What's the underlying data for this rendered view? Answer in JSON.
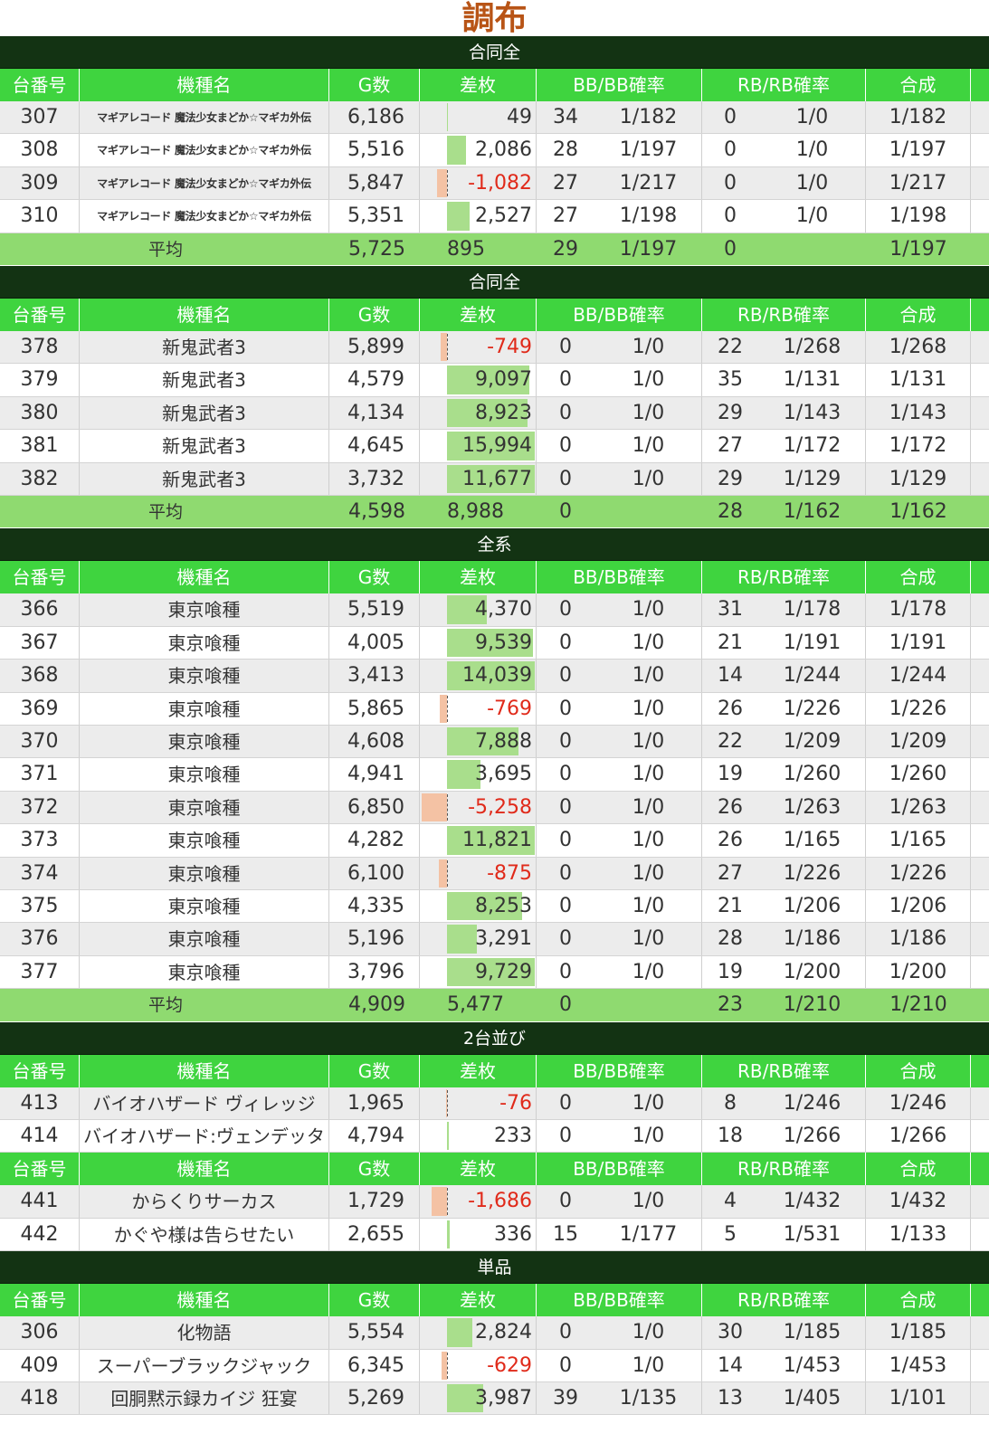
{
  "title": "調布",
  "columns": [
    "台番号",
    "機種名",
    "G数",
    "差枚",
    "BB/BB確率",
    "RB/RB確率",
    "合成"
  ],
  "avg_label": "平均",
  "colors": {
    "title": "#b85416",
    "section_bg": "#133313",
    "header_bg": "#3fd43f",
    "avg_bg": "#8fda70",
    "positive_bar": "#a9de8c",
    "negative_bar": "#f4c2a4",
    "negative_text": "#e02a1a"
  },
  "blocks": [
    {
      "section": "合同全",
      "name_style": "small",
      "rows": [
        {
          "no": "307",
          "name": "マギアレコード 魔法少女まどか☆マギカ外伝",
          "g": "6,186",
          "diff": 49,
          "diff_text": "49",
          "bb": "34",
          "bbr": "1/182",
          "rb": "0",
          "rbr": "1/0",
          "total": "1/182"
        },
        {
          "no": "308",
          "name": "マギアレコード 魔法少女まどか☆マギカ外伝",
          "g": "5,516",
          "diff": 2086,
          "diff_text": "2,086",
          "bb": "28",
          "bbr": "1/197",
          "rb": "0",
          "rbr": "1/0",
          "total": "1/197"
        },
        {
          "no": "309",
          "name": "マギアレコード 魔法少女まどか☆マギカ外伝",
          "g": "5,847",
          "diff": -1082,
          "diff_text": "-1,082",
          "bb": "27",
          "bbr": "1/217",
          "rb": "0",
          "rbr": "1/0",
          "total": "1/217"
        },
        {
          "no": "310",
          "name": "マギアレコード 魔法少女まどか☆マギカ外伝",
          "g": "5,351",
          "diff": 2527,
          "diff_text": "2,527",
          "bb": "27",
          "bbr": "1/198",
          "rb": "0",
          "rbr": "1/0",
          "total": "1/198"
        }
      ],
      "avg": {
        "g": "5,725",
        "diff": "895",
        "bb": "29",
        "bbr": "1/197",
        "rb": "0",
        "rbr": "",
        "total": "1/197"
      }
    },
    {
      "section": "合同全",
      "rows": [
        {
          "no": "378",
          "name": "新鬼武者3",
          "g": "5,899",
          "diff": -749,
          "diff_text": "-749",
          "bb": "0",
          "bbr": "1/0",
          "rb": "22",
          "rbr": "1/268",
          "total": "1/268"
        },
        {
          "no": "379",
          "name": "新鬼武者3",
          "g": "4,579",
          "diff": 9097,
          "diff_text": "9,097",
          "bb": "0",
          "bbr": "1/0",
          "rb": "35",
          "rbr": "1/131",
          "total": "1/131"
        },
        {
          "no": "380",
          "name": "新鬼武者3",
          "g": "4,134",
          "diff": 8923,
          "diff_text": "8,923",
          "bb": "0",
          "bbr": "1/0",
          "rb": "29",
          "rbr": "1/143",
          "total": "1/143"
        },
        {
          "no": "381",
          "name": "新鬼武者3",
          "g": "4,645",
          "diff": 15994,
          "diff_text": "15,994",
          "bb": "0",
          "bbr": "1/0",
          "rb": "27",
          "rbr": "1/172",
          "total": "1/172"
        },
        {
          "no": "382",
          "name": "新鬼武者3",
          "g": "3,732",
          "diff": 11677,
          "diff_text": "11,677",
          "bb": "0",
          "bbr": "1/0",
          "rb": "29",
          "rbr": "1/129",
          "total": "1/129"
        }
      ],
      "avg": {
        "g": "4,598",
        "diff": "8,988",
        "bb": "0",
        "bbr": "",
        "rb": "28",
        "rbr": "1/162",
        "total": "1/162"
      }
    },
    {
      "section": "全系",
      "rows": [
        {
          "no": "366",
          "name": "東京喰種",
          "g": "5,519",
          "diff": 4370,
          "diff_text": "4,370",
          "bb": "0",
          "bbr": "1/0",
          "rb": "31",
          "rbr": "1/178",
          "total": "1/178"
        },
        {
          "no": "367",
          "name": "東京喰種",
          "g": "4,005",
          "diff": 9539,
          "diff_text": "9,539",
          "bb": "0",
          "bbr": "1/0",
          "rb": "21",
          "rbr": "1/191",
          "total": "1/191"
        },
        {
          "no": "368",
          "name": "東京喰種",
          "g": "3,413",
          "diff": 14039,
          "diff_text": "14,039",
          "bb": "0",
          "bbr": "1/0",
          "rb": "14",
          "rbr": "1/244",
          "total": "1/244"
        },
        {
          "no": "369",
          "name": "東京喰種",
          "g": "5,865",
          "diff": -769,
          "diff_text": "-769",
          "bb": "0",
          "bbr": "1/0",
          "rb": "26",
          "rbr": "1/226",
          "total": "1/226"
        },
        {
          "no": "370",
          "name": "東京喰種",
          "g": "4,608",
          "diff": 7888,
          "diff_text": "7,888",
          "bb": "0",
          "bbr": "1/0",
          "rb": "22",
          "rbr": "1/209",
          "total": "1/209"
        },
        {
          "no": "371",
          "name": "東京喰種",
          "g": "4,941",
          "diff": 3695,
          "diff_text": "3,695",
          "bb": "0",
          "bbr": "1/0",
          "rb": "19",
          "rbr": "1/260",
          "total": "1/260"
        },
        {
          "no": "372",
          "name": "東京喰種",
          "g": "6,850",
          "diff": -5258,
          "diff_text": "-5,258",
          "bb": "0",
          "bbr": "1/0",
          "rb": "26",
          "rbr": "1/263",
          "total": "1/263"
        },
        {
          "no": "373",
          "name": "東京喰種",
          "g": "4,282",
          "diff": 11821,
          "diff_text": "11,821",
          "bb": "0",
          "bbr": "1/0",
          "rb": "26",
          "rbr": "1/165",
          "total": "1/165"
        },
        {
          "no": "374",
          "name": "東京喰種",
          "g": "6,100",
          "diff": -875,
          "diff_text": "-875",
          "bb": "0",
          "bbr": "1/0",
          "rb": "27",
          "rbr": "1/226",
          "total": "1/226"
        },
        {
          "no": "375",
          "name": "東京喰種",
          "g": "4,335",
          "diff": 8253,
          "diff_text": "8,253",
          "bb": "0",
          "bbr": "1/0",
          "rb": "21",
          "rbr": "1/206",
          "total": "1/206"
        },
        {
          "no": "376",
          "name": "東京喰種",
          "g": "5,196",
          "diff": 3291,
          "diff_text": "3,291",
          "bb": "0",
          "bbr": "1/0",
          "rb": "28",
          "rbr": "1/186",
          "total": "1/186"
        },
        {
          "no": "377",
          "name": "東京喰種",
          "g": "3,796",
          "diff": 9729,
          "diff_text": "9,729",
          "bb": "0",
          "bbr": "1/0",
          "rb": "19",
          "rbr": "1/200",
          "total": "1/200"
        }
      ],
      "avg": {
        "g": "4,909",
        "diff": "5,477",
        "bb": "0",
        "bbr": "",
        "rb": "23",
        "rbr": "1/210",
        "total": "1/210"
      }
    },
    {
      "section": "2台並び",
      "rows": [
        {
          "no": "413",
          "name": "バイオハザード ヴィレッジ",
          "g": "1,965",
          "diff": -76,
          "diff_text": "-76",
          "bb": "0",
          "bbr": "1/0",
          "rb": "8",
          "rbr": "1/246",
          "total": "1/246"
        },
        {
          "no": "414",
          "name": "バイオハザード:ヴェンデッタ",
          "g": "4,794",
          "diff": 233,
          "diff_text": "233",
          "bb": "0",
          "bbr": "1/0",
          "rb": "18",
          "rbr": "1/266",
          "total": "1/266"
        }
      ]
    },
    {
      "section": "",
      "rows": [
        {
          "no": "441",
          "name": "からくりサーカス",
          "g": "1,729",
          "diff": -1686,
          "diff_text": "-1,686",
          "bb": "0",
          "bbr": "1/0",
          "rb": "4",
          "rbr": "1/432",
          "total": "1/432"
        },
        {
          "no": "442",
          "name": "かぐや様は告らせたい",
          "g": "2,655",
          "diff": 336,
          "diff_text": "336",
          "bb": "15",
          "bbr": "1/177",
          "rb": "5",
          "rbr": "1/531",
          "total": "1/133"
        }
      ]
    },
    {
      "section": "単品",
      "rows": [
        {
          "no": "306",
          "name": "化物語",
          "g": "5,554",
          "diff": 2824,
          "diff_text": "2,824",
          "bb": "0",
          "bbr": "1/0",
          "rb": "30",
          "rbr": "1/185",
          "total": "1/185"
        },
        {
          "no": "409",
          "name": "スーパーブラックジャック",
          "g": "6,345",
          "diff": -629,
          "diff_text": "-629",
          "bb": "0",
          "bbr": "1/0",
          "rb": "14",
          "rbr": "1/453",
          "total": "1/453"
        },
        {
          "no": "418",
          "name": "回胴黙示録カイジ 狂宴",
          "g": "5,269",
          "diff": 3987,
          "diff_text": "3,987",
          "bb": "39",
          "bbr": "1/135",
          "rb": "13",
          "rbr": "1/405",
          "total": "1/101"
        }
      ]
    }
  ]
}
